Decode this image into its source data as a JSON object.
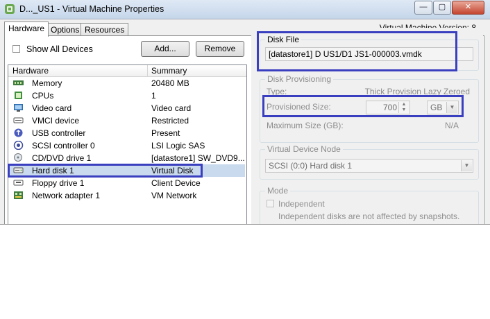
{
  "window": {
    "title": "D..._US1 - Virtual Machine Properties",
    "controls": {
      "minimize": "—",
      "maximize": "▢",
      "close": "✕"
    }
  },
  "tabs": [
    {
      "label": "Hardware",
      "active": true
    },
    {
      "label": "Options",
      "active": false
    },
    {
      "label": "Resources",
      "active": false
    }
  ],
  "vm_version": "Virtual Machine Version: 8",
  "toolbar": {
    "show_all_devices": "Show All Devices",
    "add_label": "Add...",
    "remove_label": "Remove"
  },
  "hardware_list": {
    "columns": [
      "Hardware",
      "Summary"
    ],
    "rows": [
      {
        "name": "Memory",
        "summary": "20480 MB",
        "icon": "memory-icon",
        "selected": false
      },
      {
        "name": "CPUs",
        "summary": "1",
        "icon": "cpu-icon",
        "selected": false
      },
      {
        "name": "Video card",
        "summary": "Video card",
        "icon": "monitor-icon",
        "selected": false
      },
      {
        "name": "VMCI device",
        "summary": "Restricted",
        "icon": "device-icon",
        "selected": false
      },
      {
        "name": "USB controller",
        "summary": "Present",
        "icon": "usb-icon",
        "selected": false
      },
      {
        "name": "SCSI controller 0",
        "summary": "LSI Logic SAS",
        "icon": "controller-icon",
        "selected": false
      },
      {
        "name": "CD/DVD drive 1",
        "summary": "[datastore1] SW_DVD9...",
        "icon": "cd-icon",
        "selected": false
      },
      {
        "name": "Hard disk 1",
        "summary": "Virtual Disk",
        "icon": "hard-disk-icon",
        "selected": true
      },
      {
        "name": "Floppy drive 1",
        "summary": "Client Device",
        "icon": "floppy-icon",
        "selected": false
      },
      {
        "name": "Network adapter 1",
        "summary": "VM Network",
        "icon": "network-icon",
        "selected": false
      }
    ]
  },
  "disk_file": {
    "label": "Disk File",
    "path": "[datastore1] D      US1/D1      JS1-000003.vmdk"
  },
  "disk_provisioning": {
    "label": "Disk Provisioning",
    "type_label": "Type:",
    "type_value": "Thick Provision Lazy Zeroed",
    "size_label": "Provisioned Size:",
    "size_value": "700",
    "size_unit": "GB",
    "max_label": "Maximum Size (GB):",
    "max_value": "N/A"
  },
  "virtual_device_node": {
    "label": "Virtual Device Node",
    "value": "SCSI (0:0) Hard disk 1"
  },
  "mode": {
    "label": "Mode",
    "independent_label": "Independent",
    "independent_note": "Independent disks are not affected by snapshots."
  },
  "colors": {
    "highlight_border": "#3a3fbf",
    "selection": "#c9d9ee",
    "panel": "#f0f0f0"
  }
}
